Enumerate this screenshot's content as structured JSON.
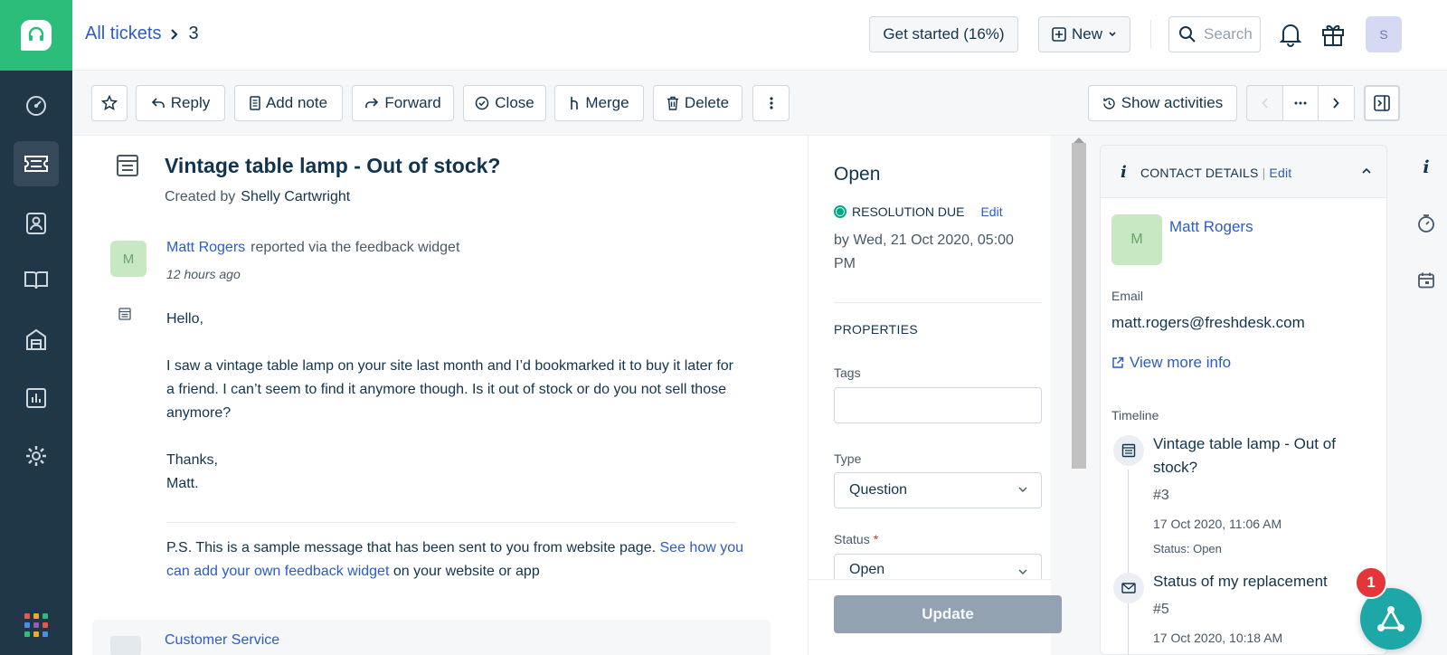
{
  "header": {
    "breadcrumb_all": "All tickets",
    "breadcrumb_id": "3",
    "get_started": "Get started (16%)",
    "new_label": "New",
    "search_placeholder": "Search",
    "avatar_initial": "S"
  },
  "toolbar": {
    "reply": "Reply",
    "add_note": "Add note",
    "forward": "Forward",
    "close": "Close",
    "merge": "Merge",
    "delete": "Delete",
    "show_activities": "Show activities"
  },
  "ticket": {
    "title": "Vintage table lamp - Out of stock?",
    "created_by_label": "Created by",
    "created_by": "Shelly Cartwright",
    "message": {
      "avatar_initial": "M",
      "author": "Matt Rogers",
      "via": "reported via the feedback widget",
      "time": "12 hours ago",
      "greeting": "Hello,",
      "body": "I saw a vintage table lamp on your site last month and I’d bookmarked it to buy it later for a friend. I can’t seem to find it anymore though. Is it out of stock or do you not sell those anymore?",
      "closing": "Thanks,",
      "signature": "Matt.",
      "ps_prefix": "P.S. This is a sample message that has been sent to you from website page.",
      "ps_link": "See how you can add your own feedback widget",
      "ps_suffix": "on your website or app"
    },
    "next_reply_author": "Customer Service"
  },
  "properties": {
    "status_heading": "Open",
    "resolution_label": "RESOLUTION DUE",
    "resolution_edit": "Edit",
    "resolution_by": "by Wed, 21 Oct 2020, 05:00 PM",
    "section_title": "PROPERTIES",
    "tags_label": "Tags",
    "tags_value": "",
    "type_label": "Type",
    "type_value": "Question",
    "status_label": "Status",
    "required_mark": "*",
    "status_value": "Open",
    "update_button": "Update"
  },
  "contact": {
    "header_title": "CONTACT DETAILS",
    "header_sep": "|",
    "header_edit": "Edit",
    "avatar_initial": "M",
    "name": "Matt Rogers",
    "email_label": "Email",
    "email": "matt.rogers@freshdesk.com",
    "view_more": "View more info",
    "timeline_label": "Timeline",
    "timeline": [
      {
        "title": "Vintage table lamp - Out of stock?",
        "id": "#3",
        "date": "17 Oct 2020, 11:06 AM",
        "status": "Status: Open"
      },
      {
        "title": "Status of my replacement",
        "id": "#5",
        "date": "17 Oct 2020, 10:18 AM"
      }
    ]
  },
  "widget": {
    "badge_count": "1"
  },
  "colors": {
    "brand_green": "#2bbe7a",
    "nav_dark": "#203748",
    "link_blue": "#2c5cc5",
    "widget_teal": "#1da7a7",
    "badge_red": "#e43538"
  }
}
